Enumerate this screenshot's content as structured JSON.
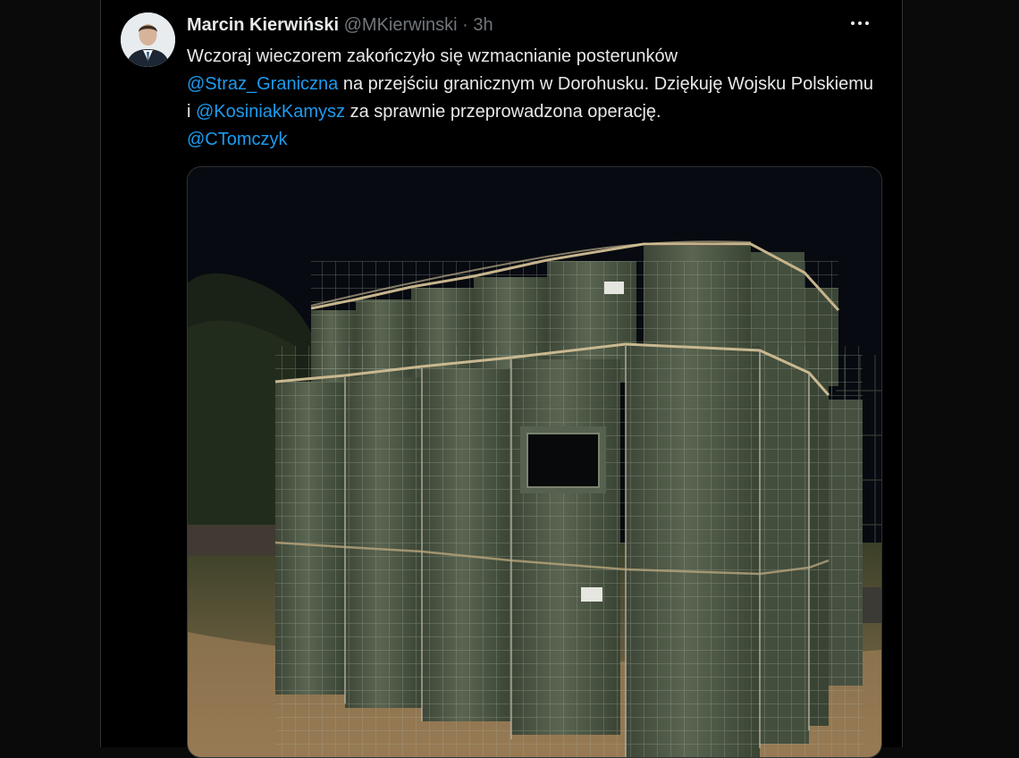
{
  "tweet": {
    "author_name": "Marcin Kierwiński",
    "handle": "@MKierwinski",
    "separator": "·",
    "time": "3h",
    "text_1": "Wczoraj wieczorem zakończyło się wzmacnianie posterunków",
    "mention_1": "@Straz_Graniczna",
    "text_2": " na przejściu granicznym w Dorohusku. Dziękuję Wojsku Polskiemu i ",
    "mention_2": "@KosiniakKamysz",
    "text_3": " za sprawnie przeprowadzona operację.",
    "mention_3": "@CTomczyk"
  },
  "colors": {
    "background": "#000000",
    "text": "#e7e9ea",
    "muted": "#71767b",
    "link": "#1d9bf0",
    "barrier": "#4f5a47"
  },
  "icons": {
    "more": "more-horizontal-icon"
  }
}
